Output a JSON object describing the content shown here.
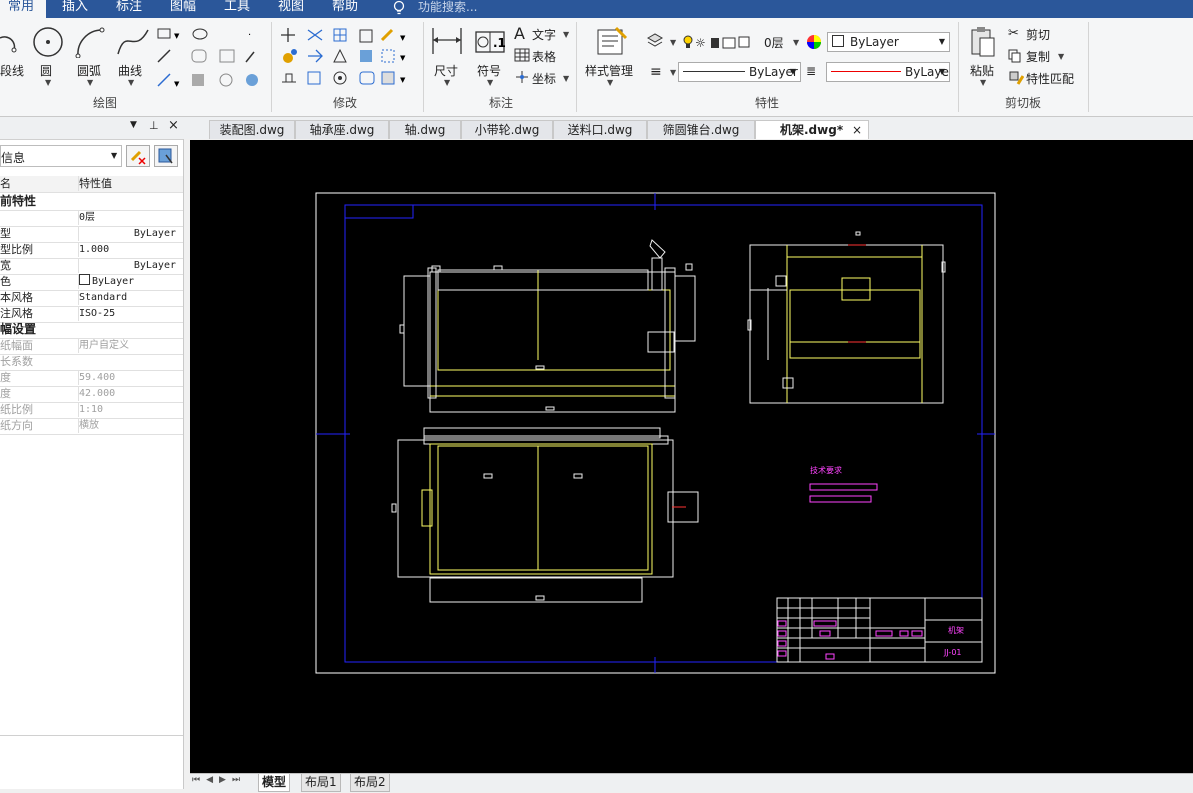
{
  "menu": [
    "常用",
    "插入",
    "标注",
    "图幅",
    "工具",
    "视图",
    "帮助"
  ],
  "search_placeholder": "功能搜索...",
  "ribbon": {
    "draw": {
      "title": "绘图",
      "polyline": "段线",
      "circle": "圆",
      "arc": "圆弧",
      "curve": "曲线"
    },
    "modify": {
      "title": "修改"
    },
    "annotate": {
      "title": "标注",
      "dimension": "尺寸",
      "symbol": "符号",
      "text": "文字",
      "table": "表格",
      "coordinate": "坐标"
    },
    "properties": {
      "title": "特性",
      "style_manager": "样式管理",
      "layer": "0层",
      "color": "ByLayer",
      "linetype": "ByLayer",
      "lineweight": "ByLayer"
    },
    "clipboard": {
      "title": "剪切板",
      "paste": "粘贴",
      "cut": "剪切",
      "copy": "复制",
      "match": "特性匹配"
    }
  },
  "panel": {
    "dropdown": "信息",
    "header_name": "名",
    "header_value": "特性值",
    "rows": [
      {
        "name": "前特性",
        "value": "",
        "cat": true
      },
      {
        "name": "",
        "value": "0层"
      },
      {
        "name": "型",
        "value": "ByLayer"
      },
      {
        "name": "型比例",
        "value": "1.000"
      },
      {
        "name": "宽",
        "value": "ByLayer"
      },
      {
        "name": "色",
        "value": "ByLayer"
      },
      {
        "name": "本风格",
        "value": "Standard"
      },
      {
        "name": "注风格",
        "value": "ISO-25"
      },
      {
        "name": "幅设置",
        "value": "",
        "cat": true
      },
      {
        "name": "纸幅面",
        "value": "用户自定义",
        "grey": true
      },
      {
        "name": "长系数",
        "value": "",
        "grey": true
      },
      {
        "name": "度",
        "value": "59.400",
        "grey": true
      },
      {
        "name": "度",
        "value": "42.000",
        "grey": true
      },
      {
        "name": "纸比例",
        "value": "1:10",
        "grey": true
      },
      {
        "name": "纸方向",
        "value": "横放",
        "grey": true
      }
    ]
  },
  "tabs": [
    {
      "label": "装配图.dwg"
    },
    {
      "label": "轴承座.dwg"
    },
    {
      "label": "轴.dwg"
    },
    {
      "label": "小带轮.dwg"
    },
    {
      "label": "送料口.dwg"
    },
    {
      "label": "筛圆锥台.dwg"
    },
    {
      "label": "机架.dwg*",
      "active": true
    }
  ],
  "drawing": {
    "title_block_name": "机架",
    "drawing_number": "JJ-01",
    "note_heading": "技术要求"
  },
  "layout_tabs": [
    {
      "label": "模型",
      "active": true
    },
    {
      "label": "布局1"
    },
    {
      "label": "布局2"
    }
  ],
  "colors": {
    "ribbon_blue": "#2b579a",
    "cad_yellow": "#ffff00",
    "cad_blue": "#0000ff",
    "cad_magenta": "#ff00ff"
  }
}
